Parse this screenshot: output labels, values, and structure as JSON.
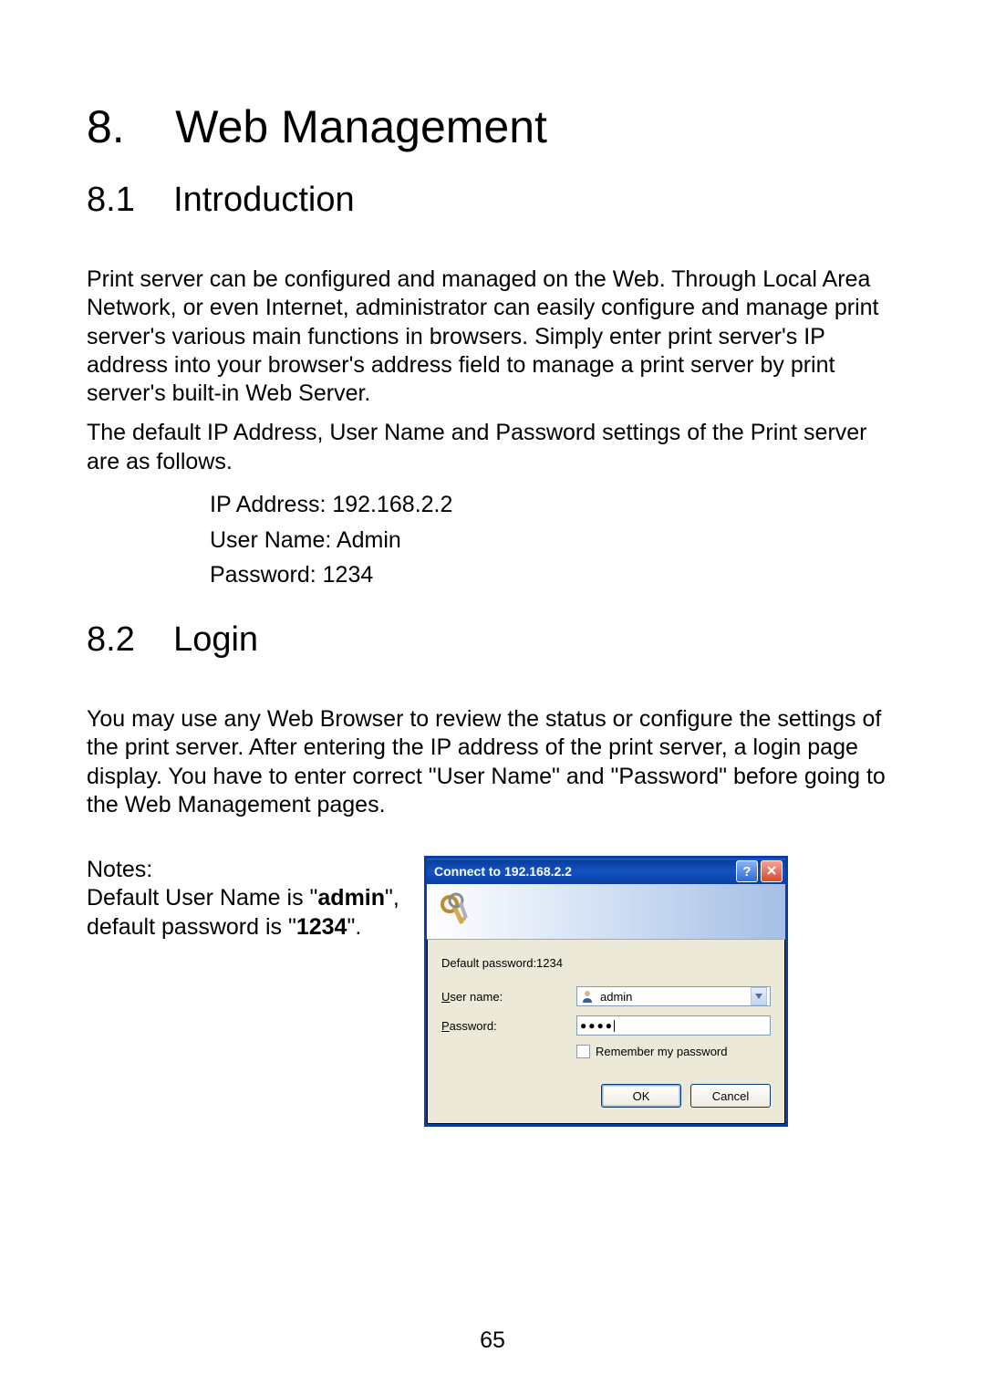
{
  "chapter": {
    "number": "8.",
    "title": "Web Management"
  },
  "section1": {
    "number": "8.1",
    "title": "Introduction",
    "para1": "Print server can be configured and managed on the Web. Through Local Area Network, or even Internet, administrator can easily configure and manage print server's various main functions in browsers. Simply enter print server's IP address into your browser's address field to manage a print server by print server's built-in Web Server.",
    "para2": "The default IP Address, User Name and Password settings of the Print server are as follows.",
    "defaults": {
      "ip": "IP Address: 192.168.2.2",
      "user": "User Name: Admin",
      "pass": "Password: 1234"
    }
  },
  "section2": {
    "number": "8.2",
    "title": "Login",
    "para1": "You may use any Web Browser to review the status or configure the settings of the print server. After entering the IP address of the print server, a login page display. You have to enter correct \"User Name\" and \"Password\" before going to the Web Management pages."
  },
  "notes": {
    "heading": "Notes:",
    "line1a": "Default User Name is \"",
    "line1b": "admin",
    "line1c": "\",",
    "line2a": "default password is \"",
    "line2b": "1234",
    "line2c": "\"."
  },
  "dialog": {
    "title": "Connect to 192.168.2.2",
    "hint": "Default password:1234",
    "userLabelPrefix": "U",
    "userLabelRest": "ser name:",
    "passLabelPrefix": "P",
    "passLabelRest": "assword:",
    "userValue": "admin",
    "passMask": "●●●●",
    "rememberPrefix": "R",
    "rememberRest": "emember my password",
    "ok": "OK",
    "cancel": "Cancel"
  },
  "pageNumber": "65"
}
